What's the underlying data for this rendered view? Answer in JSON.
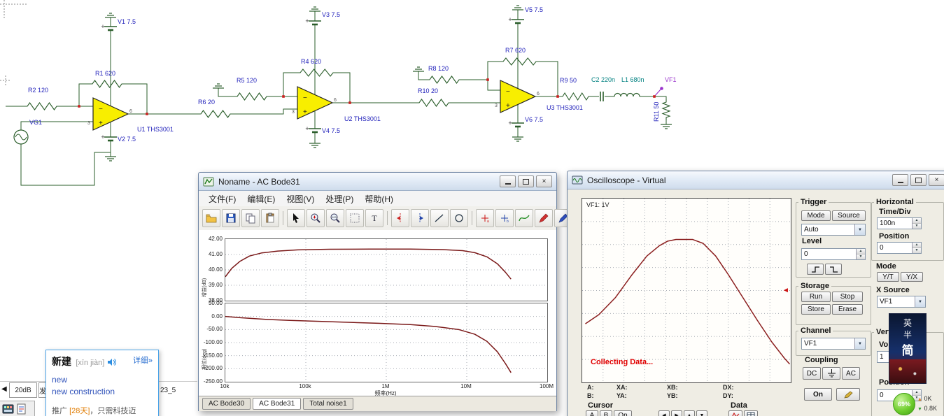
{
  "icons": {
    "dropdown_arrow": "▼",
    "spin_up": "▲",
    "spin_down": "▼",
    "arrow_left": "◀",
    "arrow_right": "▶",
    "arrow_up": "▲",
    "arrow_down": "▼",
    "close": "×",
    "marker_left": "◄",
    "tab_scroll": "◀"
  },
  "circuit": {
    "labels": {
      "vg1": "VG1",
      "r2": "R2 120",
      "r1": "R1 620",
      "v1": "V1 7.5",
      "v2": "V2 7.5",
      "u1": "U1 THS3001",
      "r6": "R6 20",
      "r5": "R5 120",
      "r4": "R4 620",
      "v3": "V3 7.5",
      "v4": "V4 7.5",
      "u2": "U2 THS3001",
      "r10": "R10 20",
      "r8": "R8 120",
      "r7": "R7 620",
      "v5": "V5 7.5",
      "v6": "V6 7.5",
      "u3": "U3 THS3001",
      "r9": "R9 50",
      "c2": "C2 220n",
      "l1": "L1 680n",
      "r11": "R11 50",
      "vf1": "VF1"
    },
    "pin_plus": "3",
    "pin_out": "6",
    "colors": {
      "wire": "#2a5d2a",
      "label": "#2222bb",
      "passive_label": "#008080",
      "probe_label": "#9933cc",
      "opamp_fill": "#f8ee00"
    }
  },
  "bode": {
    "title": "Noname - AC Bode31",
    "menu": [
      "文件(F)",
      "编辑(E)",
      "视图(V)",
      "处理(P)",
      "帮助(H)"
    ],
    "toolbar_icons": [
      "open",
      "save",
      "copy",
      "paste",
      "pointer",
      "zoom-in",
      "zoom-100",
      "grid",
      "text",
      "cursor-a",
      "cursor-b",
      "line",
      "circle",
      "marker-a",
      "marker-b",
      "interpolate",
      "pen-red",
      "pen-blue",
      "corner"
    ],
    "tabs": [
      "AC Bode30",
      "AC Bode31",
      "Total noise1"
    ],
    "active_tab": "AC Bode31"
  },
  "scope": {
    "title": "Oscilloscope - Virtual",
    "trace_label": "VF1: 1V",
    "status": "Collecting Data...",
    "readout": {
      "a": "A:",
      "b": "B:",
      "xa": "XA:",
      "ya": "YA:",
      "xb": "XB:",
      "yb": "YB:",
      "dx": "DX:",
      "dy": "DY:"
    },
    "trigger": {
      "heading": "Trigger",
      "mode": "Mode",
      "source": "Source",
      "mode_value": "Auto",
      "level": "Level",
      "level_value": "0"
    },
    "horizontal": {
      "heading": "Horizontal",
      "time_div": "Time/Div",
      "time_value": "100n",
      "position": "Position",
      "position_value": "0",
      "mode": "Mode",
      "yt": "Y/T",
      "yx": "Y/X",
      "x_source": "X Source",
      "x_source_value": "VF1"
    },
    "storage": {
      "heading": "Storage",
      "run": "Run",
      "stop": "Stop",
      "store": "Store",
      "erase": "Erase"
    },
    "channel": {
      "heading": "Channel",
      "value": "VF1"
    },
    "vertical": {
      "heading": "Vertical",
      "volts_div": "Volts/Div",
      "volts_value": "1",
      "position": "Position",
      "position_value": "0"
    },
    "coupling": {
      "heading": "Coupling",
      "dc": "DC",
      "ac": "AC"
    },
    "cursor": {
      "heading": "Cursor",
      "a": "A",
      "b": "B",
      "on": "On"
    },
    "data": {
      "heading": "Data"
    },
    "on_button": "On"
  },
  "popup": {
    "word": "新建",
    "pinyin": "[xīn jiàn]",
    "more": "详细»",
    "translations": [
      "new",
      "new construction"
    ],
    "promo_prefix": "推广 ",
    "promo_highlight": "[28天]",
    "promo_rest": "，只需科技迈"
  },
  "tabsbar": {
    "tab1": "20dB",
    "tab2": "发",
    "tab3": "23_5"
  },
  "ad": {
    "c1": "英",
    "c2": "半",
    "c3": "简"
  },
  "netmeter": {
    "percent": "69%",
    "up": "0K",
    "down": "0.8K"
  },
  "chart_data": [
    {
      "type": "line",
      "name": "ac_gain",
      "xscale": "log10",
      "xlim": [
        4,
        8
      ],
      "ylim": [
        38,
        42
      ],
      "xlabel": "频率(Hz)",
      "ylabel": "增益(dB)",
      "x_ticks": [
        "10k",
        "100k",
        "1M",
        "10M",
        "100M"
      ],
      "y_ticks": [
        "42.00",
        "41.00",
        "40.00",
        "39.00",
        "38.00"
      ],
      "grid": true,
      "legend": "none",
      "series": [
        {
          "name": "gain_dB",
          "color": "#7a1818",
          "points": [
            [
              4,
              39.55
            ],
            [
              4.08,
              40.1
            ],
            [
              4.18,
              40.55
            ],
            [
              4.3,
              40.9
            ],
            [
              4.45,
              41.1
            ],
            [
              4.65,
              41.22
            ],
            [
              4.9,
              41.3
            ],
            [
              5.3,
              41.34
            ],
            [
              5.8,
              41.35
            ],
            [
              6.3,
              41.35
            ],
            [
              6.7,
              41.32
            ],
            [
              6.95,
              41.25
            ],
            [
              7.1,
              41.12
            ],
            [
              7.25,
              40.85
            ],
            [
              7.38,
              40.4
            ],
            [
              7.48,
              39.85
            ],
            [
              7.55,
              39.4
            ]
          ]
        }
      ]
    },
    {
      "type": "line",
      "name": "ac_phase",
      "xscale": "log10",
      "xlim": [
        4,
        8
      ],
      "ylim": [
        -250,
        50
      ],
      "ylabel": "相位(deg)",
      "y_ticks": [
        "50.00",
        "0.00",
        "-50.00",
        "-100.00",
        "-150.00",
        "-200.00",
        "-250.00"
      ],
      "grid": true,
      "legend": "none",
      "series": [
        {
          "name": "phase_deg",
          "color": "#7a1818",
          "points": [
            [
              4,
              0
            ],
            [
              4.2,
              -5
            ],
            [
              4.5,
              -11
            ],
            [
              4.8,
              -15
            ],
            [
              5.1,
              -18
            ],
            [
              5.5,
              -22
            ],
            [
              5.9,
              -26
            ],
            [
              6.3,
              -31
            ],
            [
              6.6,
              -38
            ],
            [
              6.9,
              -50
            ],
            [
              7.1,
              -68
            ],
            [
              7.25,
              -95
            ],
            [
              7.38,
              -135
            ],
            [
              7.48,
              -180
            ],
            [
              7.55,
              -215
            ]
          ]
        }
      ]
    },
    {
      "type": "line",
      "name": "oscilloscope_trace",
      "xlim": [
        0,
        10
      ],
      "ylim": [
        0,
        8
      ],
      "x_unit": "div",
      "y_unit": "div",
      "grid": true,
      "series": [
        {
          "name": "VF1",
          "color": "#8b1e1e",
          "points": [
            [
              0.15,
              2.55
            ],
            [
              0.8,
              2.95
            ],
            [
              1.6,
              3.7
            ],
            [
              2.4,
              4.7
            ],
            [
              3.1,
              5.5
            ],
            [
              3.7,
              5.95
            ],
            [
              4.1,
              6.15
            ],
            [
              4.5,
              6.22
            ],
            [
              5.3,
              6.22
            ],
            [
              5.8,
              6.05
            ],
            [
              6.4,
              5.5
            ],
            [
              7.0,
              4.7
            ],
            [
              7.7,
              3.7
            ],
            [
              8.4,
              2.7
            ],
            [
              9.1,
              1.75
            ],
            [
              9.7,
              1.05
            ],
            [
              9.95,
              0.8
            ]
          ]
        }
      ]
    }
  ]
}
